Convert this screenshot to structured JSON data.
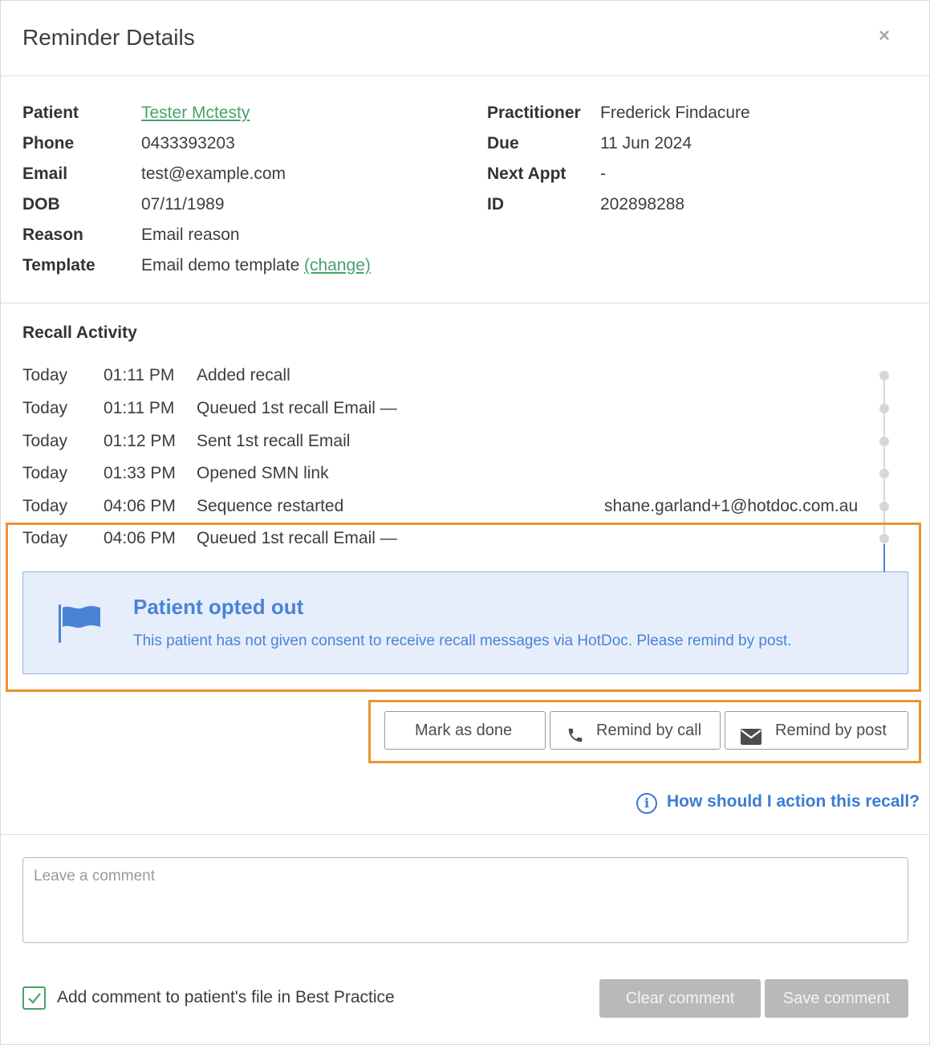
{
  "header": {
    "title": "Reminder Details",
    "close_glyph": "×"
  },
  "details": {
    "left": [
      {
        "label": "Patient",
        "value": "Tester Mctesty"
      },
      {
        "label": "Phone",
        "value": "0433393203"
      },
      {
        "label": "Email",
        "value": "test@example.com"
      },
      {
        "label": "DOB",
        "value": "07/11/1989"
      },
      {
        "label": "Reason",
        "value": "Email reason"
      },
      {
        "label": "Template",
        "value": "Email demo template",
        "link": "(change)"
      }
    ],
    "right": [
      {
        "label": "Practitioner",
        "value": "Frederick Findacure"
      },
      {
        "label": "Due",
        "value": "11 Jun 2024"
      },
      {
        "label": "Next Appt",
        "value": "-"
      },
      {
        "label": "ID",
        "value": "202898288"
      }
    ]
  },
  "activity": {
    "title": "Recall Activity",
    "rows": [
      {
        "day": "Today",
        "time": "01:11 PM",
        "event": "Added recall",
        "extra": ""
      },
      {
        "day": "Today",
        "time": "01:11 PM",
        "event": "Queued 1st recall Email —",
        "extra": ""
      },
      {
        "day": "Today",
        "time": "01:12 PM",
        "event": "Sent 1st recall Email",
        "extra": ""
      },
      {
        "day": "Today",
        "time": "01:33 PM",
        "event": "Opened SMN link",
        "extra": ""
      },
      {
        "day": "Today",
        "time": "04:06 PM",
        "event": "Sequence restarted",
        "extra": "shane.garland+1@hotdoc.com.au"
      },
      {
        "day": "Today",
        "time": "04:06 PM",
        "event": "Queued 1st recall Email —",
        "extra": ""
      }
    ],
    "optout": {
      "title": "Patient opted out",
      "text": "This patient has not given consent to receive recall messages via HotDoc. Please remind by post.",
      "icon": "flag-icon"
    }
  },
  "actions": {
    "mark_done": "Mark as done",
    "remind_call": "Remind by call",
    "remind_post": "Remind by post",
    "help": "How should I action this recall?"
  },
  "comment": {
    "placeholder": "Leave a comment",
    "checkbox_label": "Add comment to patient's file in Best Practice",
    "checkbox_checked": true,
    "clear": "Clear comment",
    "save": "Save comment"
  },
  "colors": {
    "accent_green": "#46a36a",
    "accent_blue": "#4a83d6",
    "highlight_orange": "#e8962e",
    "disabled_button": "#b9b9b9"
  }
}
